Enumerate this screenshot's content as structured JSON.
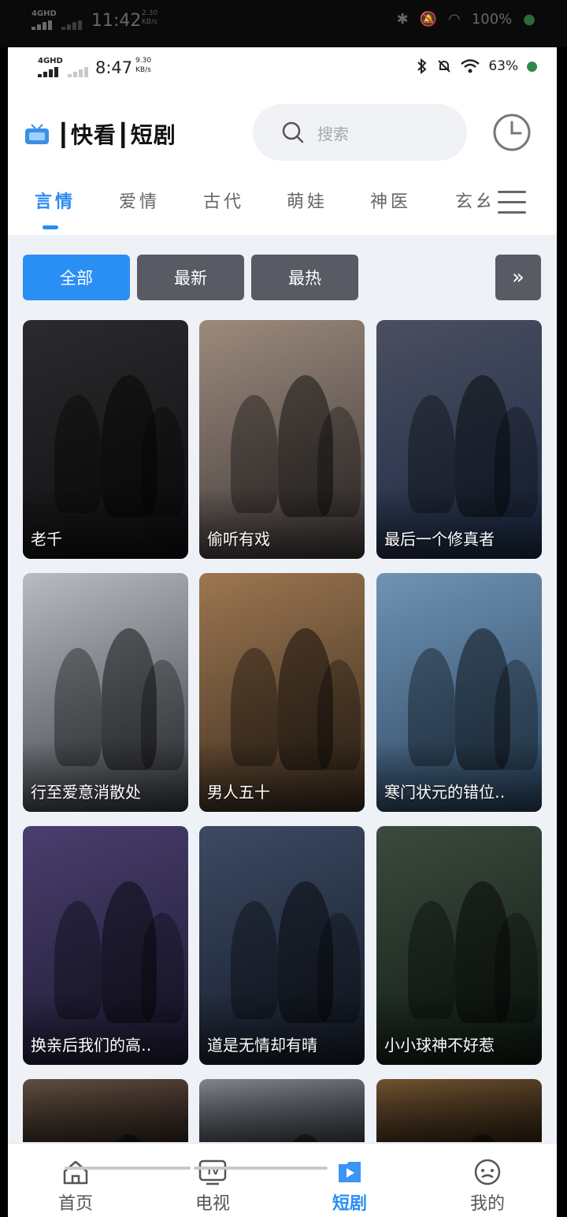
{
  "outer_status": {
    "network": "4GHD",
    "time": "11:42",
    "speed_value": "2.30",
    "speed_unit": "KB/s",
    "battery": "100%"
  },
  "status": {
    "network": "4GHD",
    "time": "8:47",
    "speed_value": "9.30",
    "speed_unit": "KB/s",
    "battery": "63%"
  },
  "header": {
    "title": "┃快看┃短剧",
    "search_placeholder": "搜索"
  },
  "tabs": [
    {
      "label": "言情",
      "active": true
    },
    {
      "label": "爱情",
      "active": false
    },
    {
      "label": "古代",
      "active": false
    },
    {
      "label": "萌娃",
      "active": false
    },
    {
      "label": "神医",
      "active": false
    },
    {
      "label": "玄幺",
      "active": false
    }
  ],
  "filters": [
    {
      "label": "全部",
      "active": true
    },
    {
      "label": "最新",
      "active": false
    },
    {
      "label": "最热",
      "active": false
    }
  ],
  "filters_more": "»",
  "cards": [
    {
      "title": "老千",
      "bg": [
        "#2b2b2e",
        "#0e0e10"
      ],
      "deco": "老千",
      "accent": "#c8c8c8"
    },
    {
      "title": "偷听有戏",
      "bg": [
        "#9c8a7c",
        "#3e3838"
      ],
      "deco": "偷听有戏",
      "accent": "#efe6df"
    },
    {
      "title": "最后一个修真者",
      "bg": [
        "#4b4f60",
        "#1b2a45"
      ],
      "deco": "最后一个修真者",
      "accent": "#e6b33a"
    },
    {
      "title": "行至爱意消散处",
      "bg": [
        "#b8bcc2",
        "#3a3d44"
      ],
      "deco": "行至爱意",
      "accent": "#e8e8e8"
    },
    {
      "title": "男人五十",
      "bg": [
        "#9c7650",
        "#3a2b1e"
      ],
      "deco": "男人五十",
      "accent": "#f2d23a"
    },
    {
      "title": "寒门状元的错位人生",
      "bg": [
        "#6f93b4",
        "#2b4560"
      ],
      "deco": "寒门状元的错位人生",
      "accent": "#ffffff"
    },
    {
      "title": "换亲后我们的高光之路",
      "bg": [
        "#4a3e6e",
        "#1c1a32"
      ],
      "deco": "换亲后我们的高光之路",
      "accent": "#f0e6ff"
    },
    {
      "title": "道是无情却有晴",
      "bg": [
        "#3c4a63",
        "#151b28"
      ],
      "deco": "道是无情却有晴",
      "accent": "#dfe6f3"
    },
    {
      "title": "小小球神不好惹",
      "bg": [
        "#3b4a3e",
        "#0f1a12"
      ],
      "deco": "小球神不好惹",
      "accent": "#ffffff"
    },
    {
      "title": "",
      "bg": [
        "#6a5446",
        "#3a2c24"
      ],
      "deco": "",
      "accent": "#ffffff"
    },
    {
      "title": "",
      "bg": [
        "#8b8f98",
        "#4a4f58"
      ],
      "deco": "",
      "accent": "#ffffff"
    },
    {
      "title": "",
      "bg": [
        "#7a5a34",
        "#3c2a18"
      ],
      "deco": "",
      "accent": "#ffffff"
    }
  ],
  "card_captions": [
    "老千",
    "偷听有戏",
    "最后一个修真者",
    "行至爱意消散处",
    "男人五十",
    "寒门状元的错位‥",
    "换亲后我们的高‥",
    "道是无情却有晴",
    "小小球神不好惹"
  ],
  "bottom_nav": [
    {
      "label": "首页",
      "icon": "home-icon",
      "active": false
    },
    {
      "label": "电视",
      "icon": "tv-icon",
      "active": false
    },
    {
      "label": "短剧",
      "icon": "play-icon",
      "active": true
    },
    {
      "label": "我的",
      "icon": "profile-face-icon",
      "active": false
    }
  ],
  "colors": {
    "accent": "#2a8ff4",
    "chip_inactive": "#585b64",
    "page_bg": "#eef1f6"
  }
}
